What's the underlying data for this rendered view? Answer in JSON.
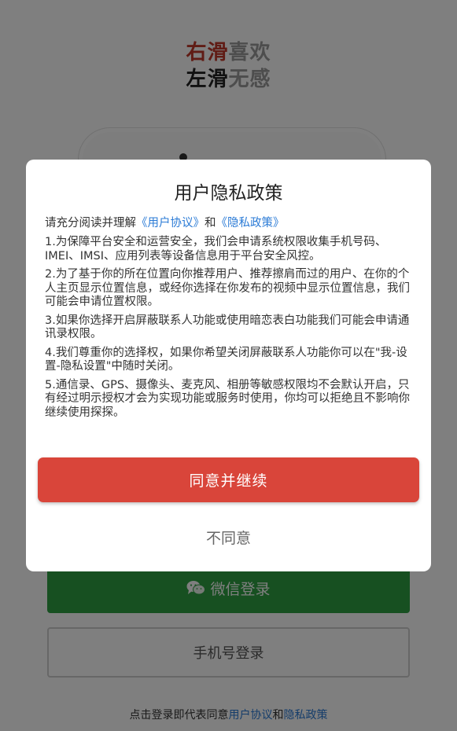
{
  "background": {
    "slogan_line1": {
      "part_a": "右滑",
      "part_b": "喜欢"
    },
    "slogan_line2": {
      "part_a": "左滑",
      "part_b": "无感"
    },
    "wechat_login_label": "微信登录",
    "phone_login_label": "手机号登录",
    "terms": {
      "prefix": "点击登录即代表同意",
      "user_agreement": "用户协议",
      "and": "和",
      "privacy_policy": "隐私政策"
    }
  },
  "modal": {
    "title": "用户隐私政策",
    "intro": {
      "prefix": "请充分阅读并理解",
      "user_agreement_link": "《用户协议》",
      "and": "和",
      "privacy_policy_link": "《隐私政策》"
    },
    "clauses": [
      "1.为保障平台安全和运营安全，我们会申请系统权限收集手机号码、IMEI、IMSI、应用列表等设备信息用于平台安全风控。",
      "2.为了基于你的所在位置向你推荐用户、推荐擦肩而过的用户、在你的个人主页显示位置信息，或经你选择在你发布的视频中显示位置信息，我们可能会申请位置权限。",
      "3.如果你选择开启屏蔽联系人功能或使用暗恋表白功能我们可能会申请通讯录权限。",
      "4.我们尊重你的选择权，如果你希望关闭屏蔽联系人功能你可以在\"我-设置-隐私设置\"中随时关闭。",
      "5.通信录、GPS、摄像头、麦克风、相册等敏感权限均不会默认开启，只有经过明示授权才会为实现功能或服务时使用，你均可以拒绝且不影响你继续使用探探。"
    ],
    "agree_label": "同意并继续",
    "disagree_label": "不同意"
  },
  "colors": {
    "accent_red": "#d9453a",
    "wechat_green": "#2ea043",
    "link_blue": "#2b7bd6"
  },
  "icons": {
    "wechat": "wechat-icon"
  }
}
